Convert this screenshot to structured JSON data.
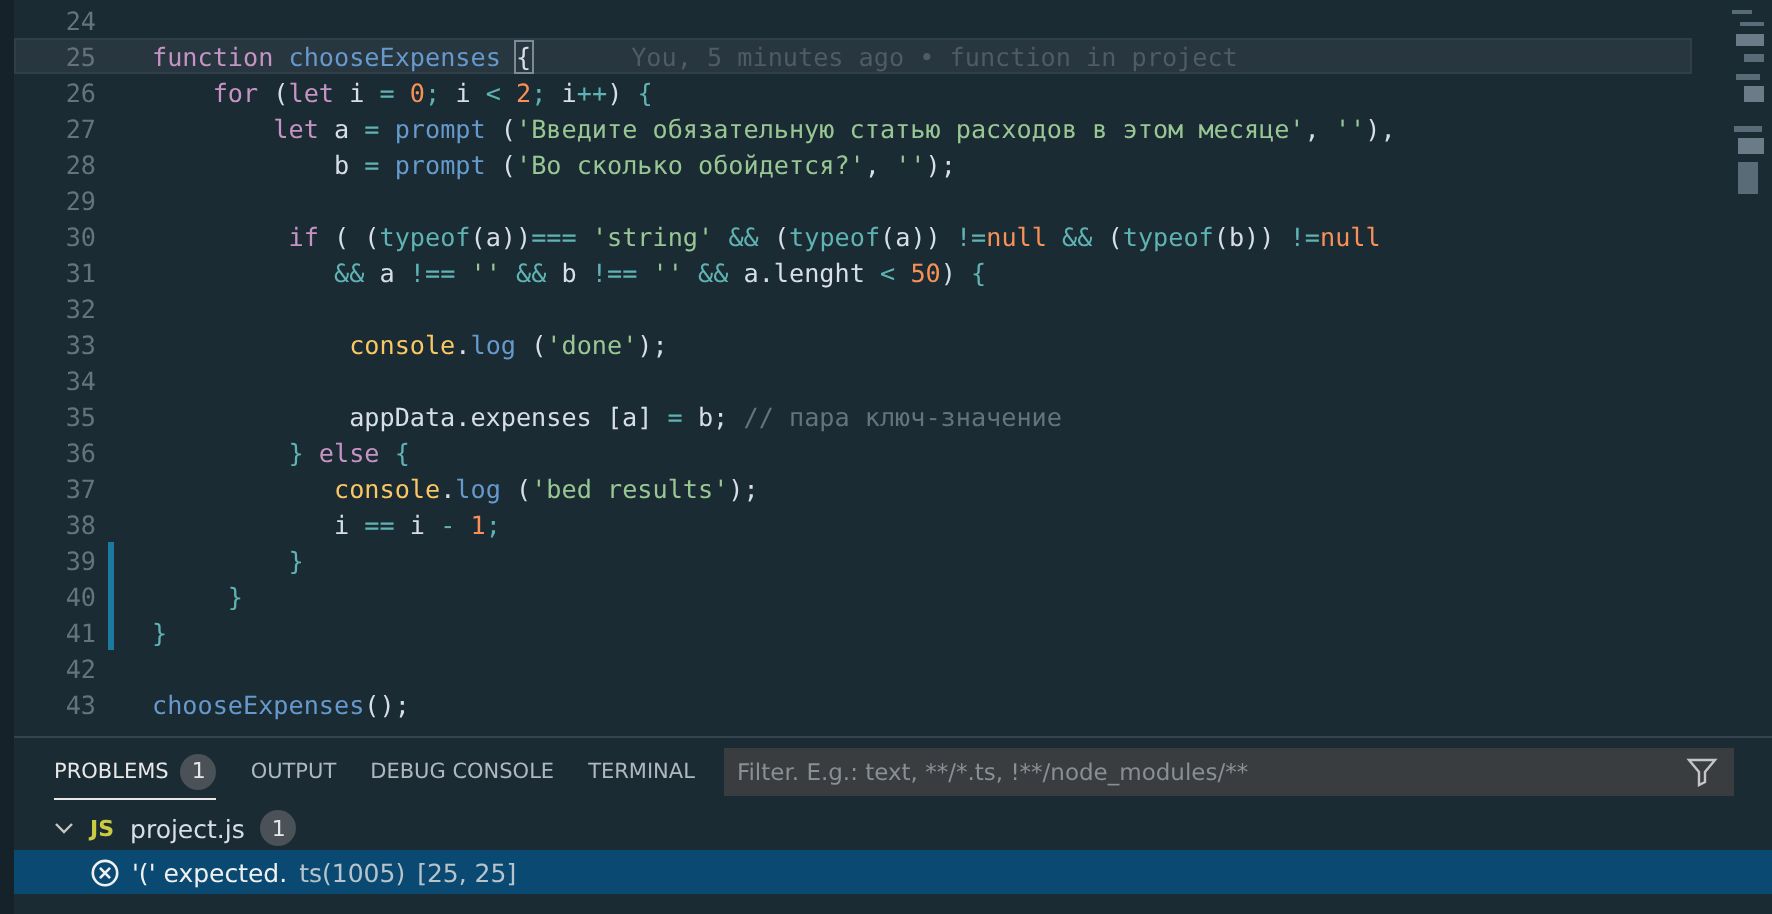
{
  "editor": {
    "lines": [
      {
        "number": "24",
        "modified": false,
        "current": false
      },
      {
        "number": "25",
        "modified": false,
        "current": true,
        "blame": "You, 5 minutes ago • function in project",
        "tokens": [
          {
            "kind": "kw",
            "text": "function "
          },
          {
            "kind": "fn",
            "text": "chooseExpenses "
          },
          {
            "kind": "match",
            "text": "{"
          }
        ]
      },
      {
        "number": "26",
        "modified": false,
        "current": false,
        "tokens": [
          {
            "kind": "kw",
            "text": "    for"
          },
          {
            "kind": "plain",
            "text": " ("
          },
          {
            "kind": "kw",
            "text": "let"
          },
          {
            "kind": "plain",
            "text": " i "
          },
          {
            "kind": "op",
            "text": "= "
          },
          {
            "kind": "num",
            "text": "0"
          },
          {
            "kind": "op",
            "text": ";"
          },
          {
            "kind": "plain",
            "text": " i "
          },
          {
            "kind": "op",
            "text": "< "
          },
          {
            "kind": "num",
            "text": "2"
          },
          {
            "kind": "op",
            "text": ";"
          },
          {
            "kind": "plain",
            "text": " i"
          },
          {
            "kind": "op",
            "text": "++"
          },
          {
            "kind": "plain",
            "text": ") "
          },
          {
            "kind": "op",
            "text": "{"
          }
        ]
      },
      {
        "number": "27",
        "modified": false,
        "current": false,
        "tokens": [
          {
            "kind": "kw",
            "text": "        let"
          },
          {
            "kind": "plain",
            "text": " a "
          },
          {
            "kind": "op",
            "text": "= "
          },
          {
            "kind": "fn",
            "text": "prompt"
          },
          {
            "kind": "plain",
            "text": " ("
          },
          {
            "kind": "str",
            "text": "'Введите обязательную статью расходов в этом месяце'"
          },
          {
            "kind": "plain",
            "text": ", "
          },
          {
            "kind": "str",
            "text": "''"
          },
          {
            "kind": "plain",
            "text": "),"
          }
        ]
      },
      {
        "number": "28",
        "modified": false,
        "current": false,
        "tokens": [
          {
            "kind": "plain",
            "text": "            b "
          },
          {
            "kind": "op",
            "text": "= "
          },
          {
            "kind": "fn",
            "text": "prompt"
          },
          {
            "kind": "plain",
            "text": " ("
          },
          {
            "kind": "str",
            "text": "'Во сколько обойдется?'"
          },
          {
            "kind": "plain",
            "text": ", "
          },
          {
            "kind": "str",
            "text": "''"
          },
          {
            "kind": "plain",
            "text": ");"
          }
        ]
      },
      {
        "number": "29",
        "modified": false,
        "current": false
      },
      {
        "number": "30",
        "modified": false,
        "current": false,
        "tokens": [
          {
            "kind": "kw",
            "text": "         if"
          },
          {
            "kind": "plain",
            "text": " ( ("
          },
          {
            "kind": "op",
            "text": "typeof"
          },
          {
            "kind": "plain",
            "text": "(a))"
          },
          {
            "kind": "op",
            "text": "=== "
          },
          {
            "kind": "str",
            "text": "'string' "
          },
          {
            "kind": "op",
            "text": "&&"
          },
          {
            "kind": "plain",
            "text": " ("
          },
          {
            "kind": "op",
            "text": "typeof"
          },
          {
            "kind": "plain",
            "text": "(a)) "
          },
          {
            "kind": "op",
            "text": "!="
          },
          {
            "kind": "num",
            "text": "null "
          },
          {
            "kind": "op",
            "text": "&&"
          },
          {
            "kind": "plain",
            "text": " ("
          },
          {
            "kind": "op",
            "text": "typeof"
          },
          {
            "kind": "plain",
            "text": "(b)) "
          },
          {
            "kind": "op",
            "text": "!="
          },
          {
            "kind": "num",
            "text": "null"
          }
        ]
      },
      {
        "number": "31",
        "modified": false,
        "current": false,
        "tokens": [
          {
            "kind": "op",
            "text": "            &&"
          },
          {
            "kind": "plain",
            "text": " a "
          },
          {
            "kind": "op",
            "text": "!== "
          },
          {
            "kind": "str",
            "text": "'' "
          },
          {
            "kind": "op",
            "text": "&&"
          },
          {
            "kind": "plain",
            "text": " b "
          },
          {
            "kind": "op",
            "text": "!== "
          },
          {
            "kind": "str",
            "text": "'' "
          },
          {
            "kind": "op",
            "text": "&&"
          },
          {
            "kind": "plain",
            "text": " a.lenght "
          },
          {
            "kind": "op",
            "text": "< "
          },
          {
            "kind": "num",
            "text": "50"
          },
          {
            "kind": "plain",
            "text": ") "
          },
          {
            "kind": "op",
            "text": "{"
          }
        ]
      },
      {
        "number": "32",
        "modified": false,
        "current": false
      },
      {
        "number": "33",
        "modified": false,
        "current": false,
        "tokens": [
          {
            "kind": "obj",
            "text": "             console"
          },
          {
            "kind": "plain",
            "text": "."
          },
          {
            "kind": "fn",
            "text": "log"
          },
          {
            "kind": "plain",
            "text": " ("
          },
          {
            "kind": "str",
            "text": "'done'"
          },
          {
            "kind": "plain",
            "text": ");"
          }
        ]
      },
      {
        "number": "34",
        "modified": false,
        "current": false
      },
      {
        "number": "35",
        "modified": false,
        "current": false,
        "tokens": [
          {
            "kind": "plain",
            "text": "             appData.expenses [a] "
          },
          {
            "kind": "op",
            "text": "="
          },
          {
            "kind": "plain",
            "text": " b; "
          },
          {
            "kind": "cmt",
            "text": "// пара ключ-значение"
          }
        ]
      },
      {
        "number": "36",
        "modified": false,
        "current": false,
        "tokens": [
          {
            "kind": "op",
            "text": "         } "
          },
          {
            "kind": "kw",
            "text": "else"
          },
          {
            "kind": "op",
            "text": " {"
          }
        ]
      },
      {
        "number": "37",
        "modified": false,
        "current": false,
        "tokens": [
          {
            "kind": "obj",
            "text": "            console"
          },
          {
            "kind": "plain",
            "text": "."
          },
          {
            "kind": "fn",
            "text": "log"
          },
          {
            "kind": "plain",
            "text": " ("
          },
          {
            "kind": "str",
            "text": "'bed results'"
          },
          {
            "kind": "plain",
            "text": ");"
          }
        ]
      },
      {
        "number": "38",
        "modified": false,
        "current": false,
        "tokens": [
          {
            "kind": "plain",
            "text": "            i "
          },
          {
            "kind": "op",
            "text": "=="
          },
          {
            "kind": "plain",
            "text": " i "
          },
          {
            "kind": "op",
            "text": "- "
          },
          {
            "kind": "num",
            "text": "1"
          },
          {
            "kind": "op",
            "text": ";"
          }
        ]
      },
      {
        "number": "39",
        "modified": true,
        "current": false,
        "tokens": [
          {
            "kind": "op",
            "text": "         }"
          }
        ]
      },
      {
        "number": "40",
        "modified": true,
        "current": false,
        "tokens": [
          {
            "kind": "op",
            "text": "     }"
          }
        ]
      },
      {
        "number": "41",
        "modified": true,
        "current": false,
        "tokens": [
          {
            "kind": "op",
            "text": "}"
          }
        ]
      },
      {
        "number": "42",
        "modified": false,
        "current": false
      },
      {
        "number": "43",
        "modified": false,
        "current": false,
        "tokens": [
          {
            "kind": "fn",
            "text": "chooseExpenses"
          },
          {
            "kind": "plain",
            "text": "();"
          }
        ]
      }
    ]
  },
  "panel": {
    "tabs": [
      {
        "label": "PROBLEMS",
        "badge": "1",
        "selected": true
      },
      {
        "label": "OUTPUT",
        "selected": false
      },
      {
        "label": "DEBUG CONSOLE",
        "selected": false
      },
      {
        "label": "TERMINAL",
        "selected": false
      }
    ],
    "filter": {
      "placeholder": "Filter. E.g.: text, **/*.ts, !**/node_modules/**"
    },
    "files": [
      {
        "badge_text": "JS",
        "name": "project.js",
        "count": "1",
        "expanded": true,
        "problems": [
          {
            "message": "'(' expected.",
            "source": "ts(1005)",
            "position": "[25, 25]",
            "selected": true
          }
        ]
      }
    ]
  }
}
